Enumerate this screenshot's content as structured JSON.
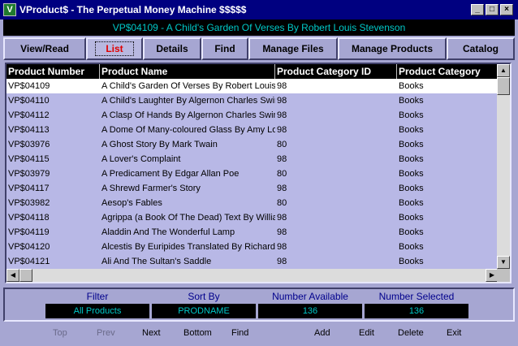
{
  "window": {
    "title": "VProduct$ - The Perpetual Money Machine $$$$$",
    "icon_text": "V"
  },
  "header": {
    "text": "VP$04109 - A Child's Garden Of Verses By Robert Louis Stevenson"
  },
  "tabs": [
    {
      "label": "View/Read"
    },
    {
      "label": "List"
    },
    {
      "label": "Details"
    },
    {
      "label": "Find"
    },
    {
      "label": "Manage Files"
    },
    {
      "label": "Manage Products"
    },
    {
      "label": "Catalog"
    }
  ],
  "table": {
    "columns": [
      "Product Number",
      "Product Name",
      "Product Category ID",
      "Product Category"
    ],
    "rows": [
      [
        "VP$04109",
        "A Child's Garden Of Verses By Robert Louis Stevenson",
        "98",
        "Books"
      ],
      [
        "VP$04110",
        "A Child's Laughter By Algernon Charles Swinburne",
        "98",
        "Books"
      ],
      [
        "VP$04112",
        "A Clasp Of Hands By Algernon Charles Swinburne",
        "98",
        "Books"
      ],
      [
        "VP$04113",
        "A Dome Of Many-coloured Glass By Amy Lowell",
        "98",
        "Books"
      ],
      [
        "VP$03976",
        "A Ghost Story By Mark Twain",
        "80",
        "Books"
      ],
      [
        "VP$04115",
        "A Lover's Complaint",
        "98",
        "Books"
      ],
      [
        "VP$03979",
        "A Predicament By Edgar Allan Poe",
        "80",
        "Books"
      ],
      [
        "VP$04117",
        "A Shrewd Farmer's Story",
        "98",
        "Books"
      ],
      [
        "VP$03982",
        "Aesop's Fables",
        "80",
        "Books"
      ],
      [
        "VP$04118",
        "Agrippa (a Book Of The Dead) Text By William Gibson",
        "98",
        "Books"
      ],
      [
        "VP$04119",
        "Aladdin And The Wonderful Lamp",
        "98",
        "Books"
      ],
      [
        "VP$04120",
        "Alcestis By Euripides Translated By Richard Aldington",
        "98",
        "Books"
      ],
      [
        "VP$04121",
        "Ali And The Sultan's Saddle",
        "98",
        "Books"
      ]
    ]
  },
  "status": {
    "filter_label": "Filter",
    "filter_value": "All Products",
    "sort_label": "Sort By",
    "sort_value": "PRODNAME",
    "available_label": "Number Available",
    "available_value": "136",
    "selected_label": "Number Selected",
    "selected_value": "136"
  },
  "nav": {
    "top": "Top",
    "prev": "Prev",
    "next": "Next",
    "bottom": "Bottom",
    "find": "Find",
    "add": "Add",
    "edit": "Edit",
    "delete": "Delete",
    "exit": "Exit"
  },
  "icons": {
    "minimize": "minimize-icon",
    "maximize": "maximize-icon",
    "close": "close-icon",
    "scroll_up": "arrow-up-icon",
    "scroll_down": "arrow-down-icon",
    "scroll_left": "arrow-left-icon",
    "scroll_right": "arrow-right-icon"
  },
  "colors": {
    "titlebar": "#000080",
    "panel": "#a6a6d2",
    "row": "#b8b8e6",
    "header_text": "#00c8c8",
    "active_tab_text": "#e00000"
  }
}
